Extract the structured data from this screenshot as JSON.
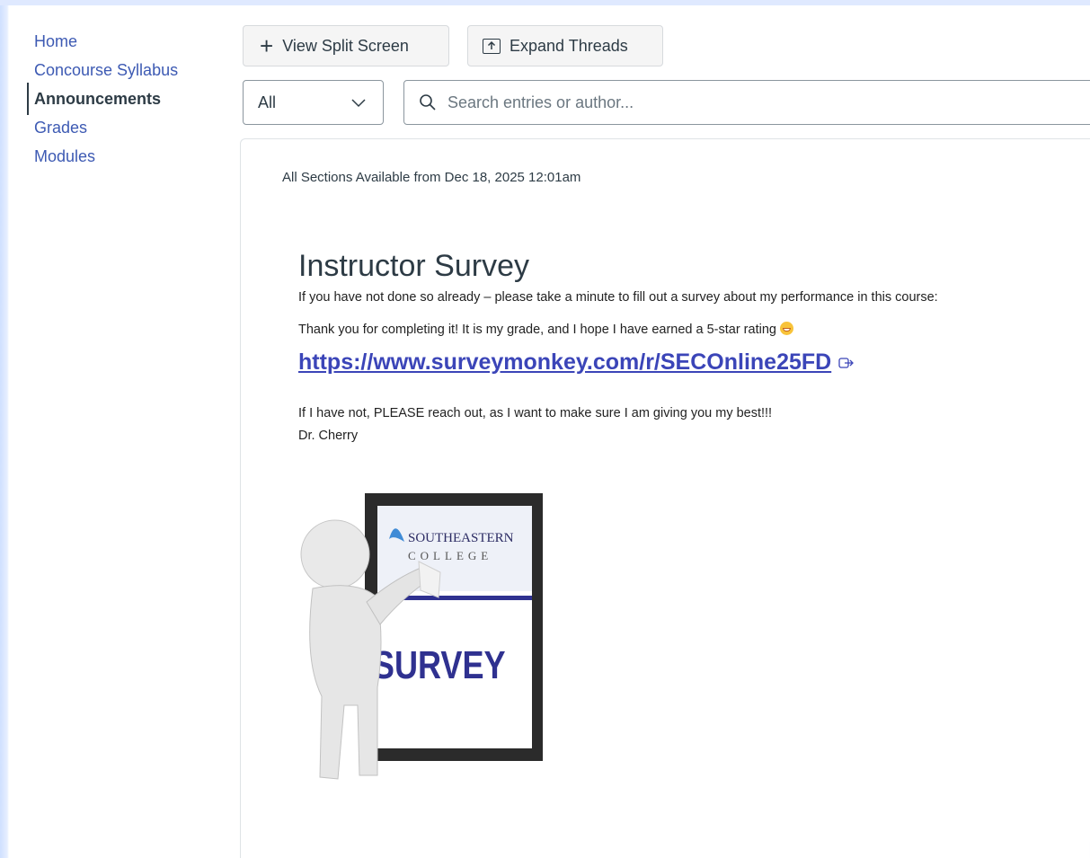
{
  "sidebar": {
    "items": [
      {
        "label": "Home",
        "active": false
      },
      {
        "label": "Concourse Syllabus",
        "active": false
      },
      {
        "label": "Announcements",
        "active": true
      },
      {
        "label": "Grades",
        "active": false
      },
      {
        "label": "Modules",
        "active": false
      }
    ]
  },
  "toolbar": {
    "split_label": "View Split Screen",
    "split_icon": "plus-icon",
    "expand_label": "Expand Threads",
    "expand_icon": "expand-icon"
  },
  "filter": {
    "selected": "All"
  },
  "search": {
    "placeholder": "Search entries or author..."
  },
  "announcement": {
    "availability": "All Sections Available from Dec 18, 2025 12:01am",
    "title": "Instructor Survey",
    "para1": "If you have not done so already – please take a minute to fill out a survey about my performance in this course:",
    "para2": "Thank you for completing it! It is my grade, and I hope I have earned a 5-star rating",
    "link": "https://www.surveymonkey.com/r/SECOnline25FD",
    "para4": " If I have not, PLEASE reach out, as I want to make sure I am giving you my best!!!",
    "signature": "Dr. Cherry",
    "image": {
      "sign_college_top": "SOUTHEASTERN",
      "sign_college_bottom": "COLLEGE",
      "sign_word": "SURVEY"
    }
  },
  "colors": {
    "link": "#3b45b8",
    "nav": "#3d5ab3",
    "text": "#2d3b45"
  }
}
